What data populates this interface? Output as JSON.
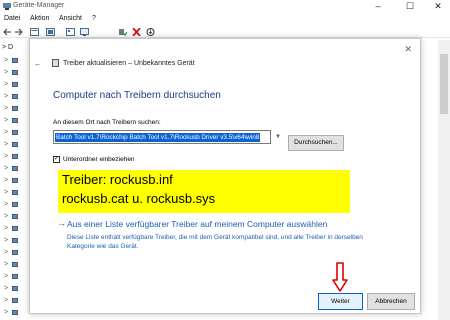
{
  "window": {
    "title": "Geräte-Manager",
    "minimize": "–",
    "maximize": "☐",
    "close": "✕"
  },
  "menu": [
    "Datei",
    "Aktion",
    "Ansicht",
    "?"
  ],
  "toolbar_icons": [
    "back-icon",
    "forward-icon",
    "properties-icon",
    "help-icon",
    "update-driver-icon",
    "scan-icon",
    "enable-icon",
    "uninstall-icon",
    "download-icon"
  ],
  "tree": {
    "root_label": "D",
    "expand_glyph": ">"
  },
  "dialog": {
    "title": "Treiber aktualisieren – Unbekanntes Gerät",
    "close": "✕",
    "back": "←",
    "heading": "Computer nach Treibern durchsuchen",
    "path_label": "An diesem Ort nach Treibern suchen:",
    "path_value": "Batch Tool v1.7\\Rockchip Batch Tool v1.7\\Rockusb Driver v3.5\\x64\\win8",
    "browse_button": "Durchsuchen...",
    "include_subfolders_label": "Unterordner einbeziehen",
    "include_subfolders_checked": true,
    "note_line1": "Treiber: rockusb.inf",
    "note_line2": "rockusb.cat  u.  rockusb.sys",
    "list_link_arrow": "→",
    "list_link": "Aus einer Liste verfügbarer Treiber auf meinem Computer auswählen",
    "list_description": "Diese Liste enthält verfügbare Treiber, die mit dem Gerät kompatibel sind, und alle Treiber in derselben Kategorie wie das Gerät.",
    "next_button": "Weiter",
    "cancel_button": "Abbrechen"
  },
  "colors": {
    "accent_blue": "#1a5fb4",
    "heading_blue": "#1e3b8a",
    "highlight": "#ffff00",
    "annotation_red": "#e00000",
    "selection_blue": "#0a62d6"
  }
}
